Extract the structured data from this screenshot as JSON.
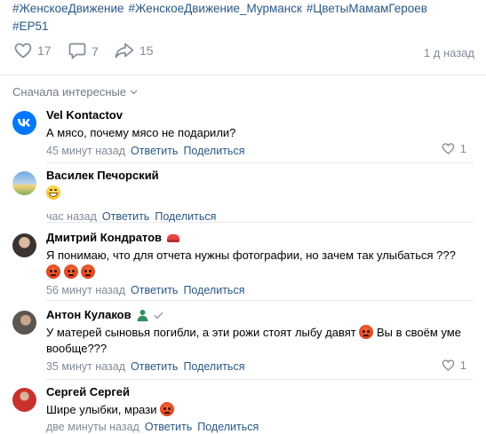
{
  "post": {
    "hashtags": [
      "#ЖенскоеДвижение",
      "#ЖенскоеДвижение_Мурманск",
      "#ЦветыМамамГероев",
      "#EP51"
    ],
    "likes": "17",
    "comments": "7",
    "shares": "15",
    "time": "1 д назад"
  },
  "sort_label": "Сначала интересные",
  "comments": [
    {
      "author": "Vel Kontactov",
      "text": "А мясо, почему мясо не подарили?",
      "time": "45 минут назад",
      "reply": "Ответить",
      "share": "Поделиться",
      "likes": "1"
    },
    {
      "author": "Василек Печорский",
      "time": "час назад",
      "reply": "Ответить",
      "share": "Поделиться"
    },
    {
      "author": "Дмитрий Кондратов",
      "text": "Я понимаю, что для отчета нужны фотографии, но зачем так улыбаться ???",
      "time": "56 минут назад",
      "reply": "Ответить",
      "share": "Поделиться"
    },
    {
      "author": "Антон Кулаков",
      "text_part1": "У матерей сыновья погибли, а эти рожи стоят лыбу давят",
      "text_part2": "Вы в своём уме вообще???",
      "time": "35 минут назад",
      "reply": "Ответить",
      "share": "Поделиться",
      "likes": "1"
    },
    {
      "author": "Сергей Сергей",
      "text": "Шире улыбки, мрази",
      "time": "две минуты назад",
      "reply": "Ответить",
      "share": "Поделиться"
    }
  ],
  "colors": {
    "link": "#2a5885",
    "muted": "#818c99",
    "divider": "#e7e8ec",
    "vk_blue": "#0077ff"
  }
}
